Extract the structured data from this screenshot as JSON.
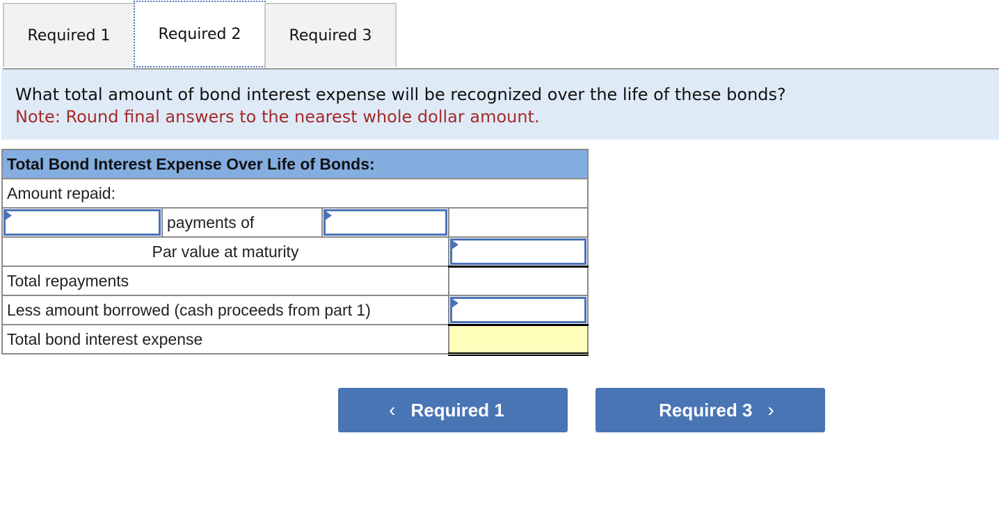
{
  "tabs": [
    {
      "label": "Required 1",
      "active": false
    },
    {
      "label": "Required 2",
      "active": true
    },
    {
      "label": "Required 3",
      "active": false
    }
  ],
  "question": {
    "text": "What total amount of bond interest expense will be recognized over the life of these bonds?",
    "note": "Note: Round final answers to the nearest whole dollar amount."
  },
  "table": {
    "header": "Total Bond Interest Expense Over Life of Bonds:",
    "amount_repaid_label": "Amount repaid:",
    "payments_of_label": "payments of",
    "par_value_label": "Par value at maturity",
    "total_repayments_label": "Total repayments",
    "less_borrowed_label": "Less amount borrowed (cash proceeds from part 1)",
    "total_expense_label": "Total bond interest expense",
    "inputs": {
      "num_payments": "",
      "payment_amount": "",
      "par_value": "",
      "amount_borrowed": "",
      "total_repayments": "",
      "total_expense": ""
    }
  },
  "nav": {
    "prev_label": "Required 1",
    "next_label": "Required 3",
    "prev_icon": "‹",
    "next_icon": "›"
  }
}
